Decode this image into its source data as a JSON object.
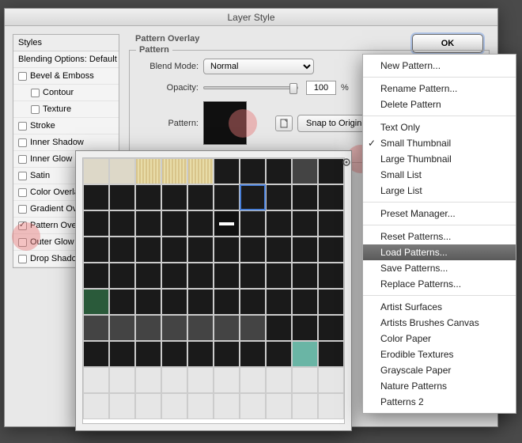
{
  "window": {
    "title": "Layer Style"
  },
  "ok_label": "OK",
  "styles": {
    "header": "Styles",
    "blending": "Blending Options: Default",
    "items": [
      {
        "label": "Bevel & Emboss",
        "checked": false,
        "indent": false
      },
      {
        "label": "Contour",
        "checked": false,
        "indent": true
      },
      {
        "label": "Texture",
        "checked": false,
        "indent": true
      },
      {
        "label": "Stroke",
        "checked": false,
        "indent": false
      },
      {
        "label": "Inner Shadow",
        "checked": false,
        "indent": false
      },
      {
        "label": "Inner Glow",
        "checked": false,
        "indent": false
      },
      {
        "label": "Satin",
        "checked": false,
        "indent": false
      },
      {
        "label": "Color Overlay",
        "checked": false,
        "indent": false
      },
      {
        "label": "Gradient Overlay",
        "checked": false,
        "indent": false
      },
      {
        "label": "Pattern Overlay",
        "checked": true,
        "indent": false
      },
      {
        "label": "Outer Glow",
        "checked": false,
        "indent": false
      },
      {
        "label": "Drop Shadow",
        "checked": false,
        "indent": false
      }
    ]
  },
  "overlay": {
    "section_title": "Pattern Overlay",
    "group_title": "Pattern",
    "blend_mode_label": "Blend Mode:",
    "blend_mode_value": "Normal",
    "opacity_label": "Opacity:",
    "opacity_value": "100",
    "opacity_unit": "%",
    "pattern_label": "Pattern:",
    "snap_label": "Snap to Origin"
  },
  "menu": {
    "items": [
      {
        "label": "New Pattern..."
      },
      {
        "sep": true
      },
      {
        "label": "Rename Pattern..."
      },
      {
        "label": "Delete Pattern"
      },
      {
        "sep": true
      },
      {
        "label": "Text Only"
      },
      {
        "label": "Small Thumbnail",
        "checked": true
      },
      {
        "label": "Large Thumbnail"
      },
      {
        "label": "Small List"
      },
      {
        "label": "Large List"
      },
      {
        "sep": true
      },
      {
        "label": "Preset Manager..."
      },
      {
        "sep": true
      },
      {
        "label": "Reset Patterns..."
      },
      {
        "label": "Load Patterns...",
        "highlighted": true
      },
      {
        "label": "Save Patterns..."
      },
      {
        "label": "Replace Patterns..."
      },
      {
        "sep": true
      },
      {
        "label": "Artist Surfaces"
      },
      {
        "label": "Artists Brushes Canvas"
      },
      {
        "label": "Color Paper"
      },
      {
        "label": "Erodible Textures"
      },
      {
        "label": "Grayscale Paper"
      },
      {
        "label": "Nature Patterns"
      },
      {
        "label": "Patterns 2"
      }
    ]
  },
  "picker": {
    "rows": 10,
    "cols": 10
  }
}
